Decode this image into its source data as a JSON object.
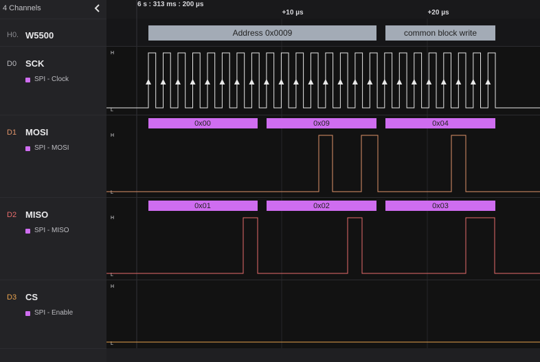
{
  "sidebar": {
    "title": "4 Channels",
    "collapse_icon": "chevron-left-icon",
    "rows": [
      {
        "id": "H0.",
        "name": "W5500",
        "id_color": "#8a8a8f"
      },
      {
        "id": "D0",
        "name": "SCK",
        "id_color": "#b9b9be",
        "analyzer": "SPI - Clock"
      },
      {
        "id": "D1",
        "name": "MOSI",
        "id_color": "#e0946a",
        "analyzer": "SPI - MOSI"
      },
      {
        "id": "D2",
        "name": "MISO",
        "id_color": "#e86c6c",
        "analyzer": "SPI - MISO"
      },
      {
        "id": "D3",
        "name": "CS",
        "id_color": "#e8a24e",
        "analyzer": "SPI - Enable"
      }
    ]
  },
  "timeline": {
    "origin": "6 s : 313 ms : 200 µs",
    "ticks": [
      "+10 µs",
      "+20 µs"
    ]
  },
  "levels": {
    "high": "H",
    "low": "L"
  },
  "hla_frames": [
    "Address 0x0009",
    "common block write"
  ],
  "mosi_frames": [
    "0x00",
    "0x09",
    "0x04"
  ],
  "miso_frames": [
    "0x01",
    "0x02",
    "0x03"
  ],
  "colors": {
    "sck": "#e8e8e8",
    "mosi": "#e0946a",
    "miso": "#e86c6c",
    "cs": "#e8a24e",
    "frame": "#cf6df0",
    "hla": "#a3abb6"
  }
}
